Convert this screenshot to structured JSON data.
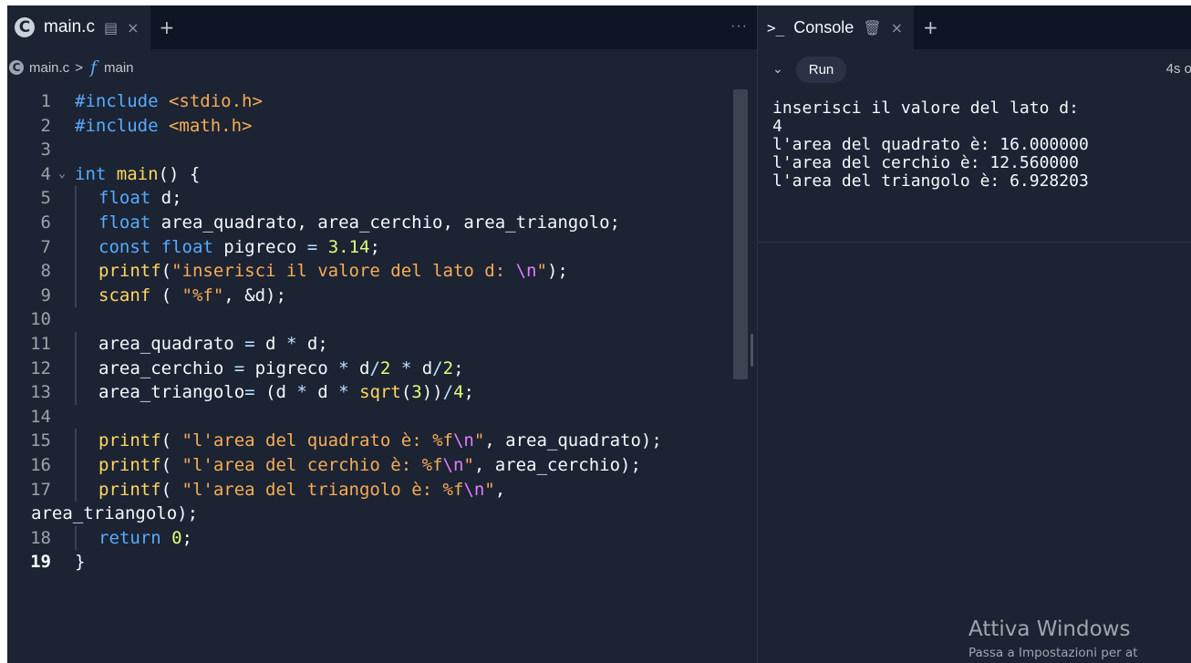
{
  "editor": {
    "tab": {
      "title": "main.c"
    },
    "breadcrumb": {
      "file": "main.c",
      "separator": ">",
      "function": "main"
    },
    "more_label": "···",
    "lines": [
      {
        "n": "1",
        "html": "<span class=\"kw\">#include</span> <span class=\"inc\">&lt;stdio.h&gt;</span>"
      },
      {
        "n": "2",
        "html": "<span class=\"kw\">#include</span> <span class=\"inc\">&lt;math.h&gt;</span>"
      },
      {
        "n": "3",
        "html": ""
      },
      {
        "n": "4",
        "fold": true,
        "html": "<span class=\"kw\">int</span> <span class=\"fnname\">main</span>() {"
      },
      {
        "n": "5",
        "indent": true,
        "html": "<span class=\"kw\">float</span> d;"
      },
      {
        "n": "6",
        "indent": true,
        "html": "<span class=\"kw\">float</span> area_quadrato, area_cerchio, area_triangolo;"
      },
      {
        "n": "7",
        "indent": true,
        "html": "<span class=\"kw\">const float</span> pigreco <span class=\"op\">=</span> <span class=\"num\">3.14</span>;"
      },
      {
        "n": "8",
        "indent": true,
        "html": "<span class=\"fnname\">printf</span>(<span class=\"str\">\"inserisci il valore del lato d: </span><span class=\"esc\">\\n</span><span class=\"str\">\"</span>);"
      },
      {
        "n": "9",
        "indent": true,
        "html": "<span class=\"fnname\">scanf</span> ( <span class=\"str\">\"%f\"</span>, &amp;d);"
      },
      {
        "n": "10",
        "html": ""
      },
      {
        "n": "11",
        "indent": true,
        "html": "area_quadrato <span class=\"op\">=</span> d <span class=\"op\">*</span> d;"
      },
      {
        "n": "12",
        "indent": true,
        "html": "area_cerchio <span class=\"op\">=</span> pigreco <span class=\"op\">*</span> d<span class=\"op\">/</span><span class=\"num\">2</span> <span class=\"op\">*</span> d<span class=\"op\">/</span><span class=\"num\">2</span>;"
      },
      {
        "n": "13",
        "indent": true,
        "html": "area_triangolo<span class=\"op\">=</span> (d <span class=\"op\">*</span> d <span class=\"op\">*</span> <span class=\"fnname\">sqrt</span>(<span class=\"num\">3</span>))<span class=\"op\">/</span><span class=\"num\">4</span>;"
      },
      {
        "n": "14",
        "html": ""
      },
      {
        "n": "15",
        "indent": true,
        "html": "<span class=\"fnname\">printf</span>( <span class=\"str\">\"l'area del quadrato è: %f</span><span class=\"esc\">\\n</span><span class=\"str\">\"</span>, area_quadrato);"
      },
      {
        "n": "16",
        "indent": true,
        "html": "<span class=\"fnname\">printf</span>( <span class=\"str\">\"l'area del cerchio è: %f</span><span class=\"esc\">\\n</span><span class=\"str\">\"</span>, area_cerchio);"
      },
      {
        "n": "17",
        "indent": true,
        "html": "<span class=\"fnname\">printf</span>( <span class=\"str\">\"l'area del triangolo è: %f</span><span class=\"esc\">\\n</span><span class=\"str\">\"</span>,"
      },
      {
        "n": "",
        "wrap": true,
        "html": "area_triangolo);"
      },
      {
        "n": "18",
        "indent": true,
        "html": "<span class=\"kw\">return</span> <span class=\"num\">0</span>;"
      },
      {
        "n": "19",
        "active": true,
        "html": "}"
      }
    ]
  },
  "console": {
    "tab": {
      "title": "Console",
      "prompt": ">_"
    },
    "run_label": "Run",
    "elapsed": "4s o",
    "output": "inserisci il valore del lato d:\n4\nl'area del quadrato è: 16.000000\nl'area del cerchio è: 12.560000\nl'area del triangolo è: 6.928203"
  },
  "watermark": {
    "title": "Attiva Windows",
    "subtitle": "Passa a Impostazioni per at"
  },
  "icons": {
    "file_logo": "replit-c-logo-icon",
    "tab_options": "tab-options-icon",
    "close": "close-icon",
    "add": "plus-icon",
    "trash": "trash-icon",
    "chevron": "chevron-down-icon",
    "function": "function-icon"
  }
}
